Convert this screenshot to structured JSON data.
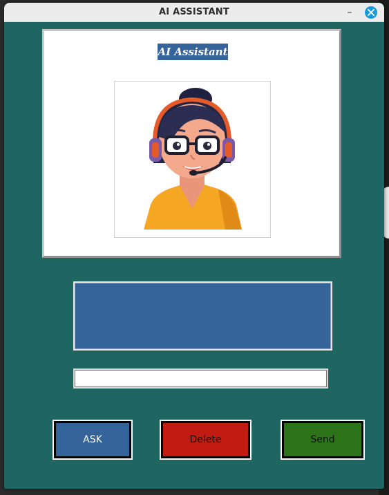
{
  "window": {
    "title": "AI ASSISTANT",
    "minimize_glyph": "–",
    "background_color": "#1f6663"
  },
  "header_panel": {
    "brand_label": "AI Assistant",
    "avatar_icon": "support-agent-headset-woman"
  },
  "output": {
    "text": ""
  },
  "input": {
    "value": "",
    "placeholder": ""
  },
  "buttons": {
    "ask_label": "ASK",
    "delete_label": "Delete",
    "send_label": "Send",
    "ask_color": "#34649a",
    "delete_color": "#c11b12",
    "send_color": "#2d7319"
  }
}
